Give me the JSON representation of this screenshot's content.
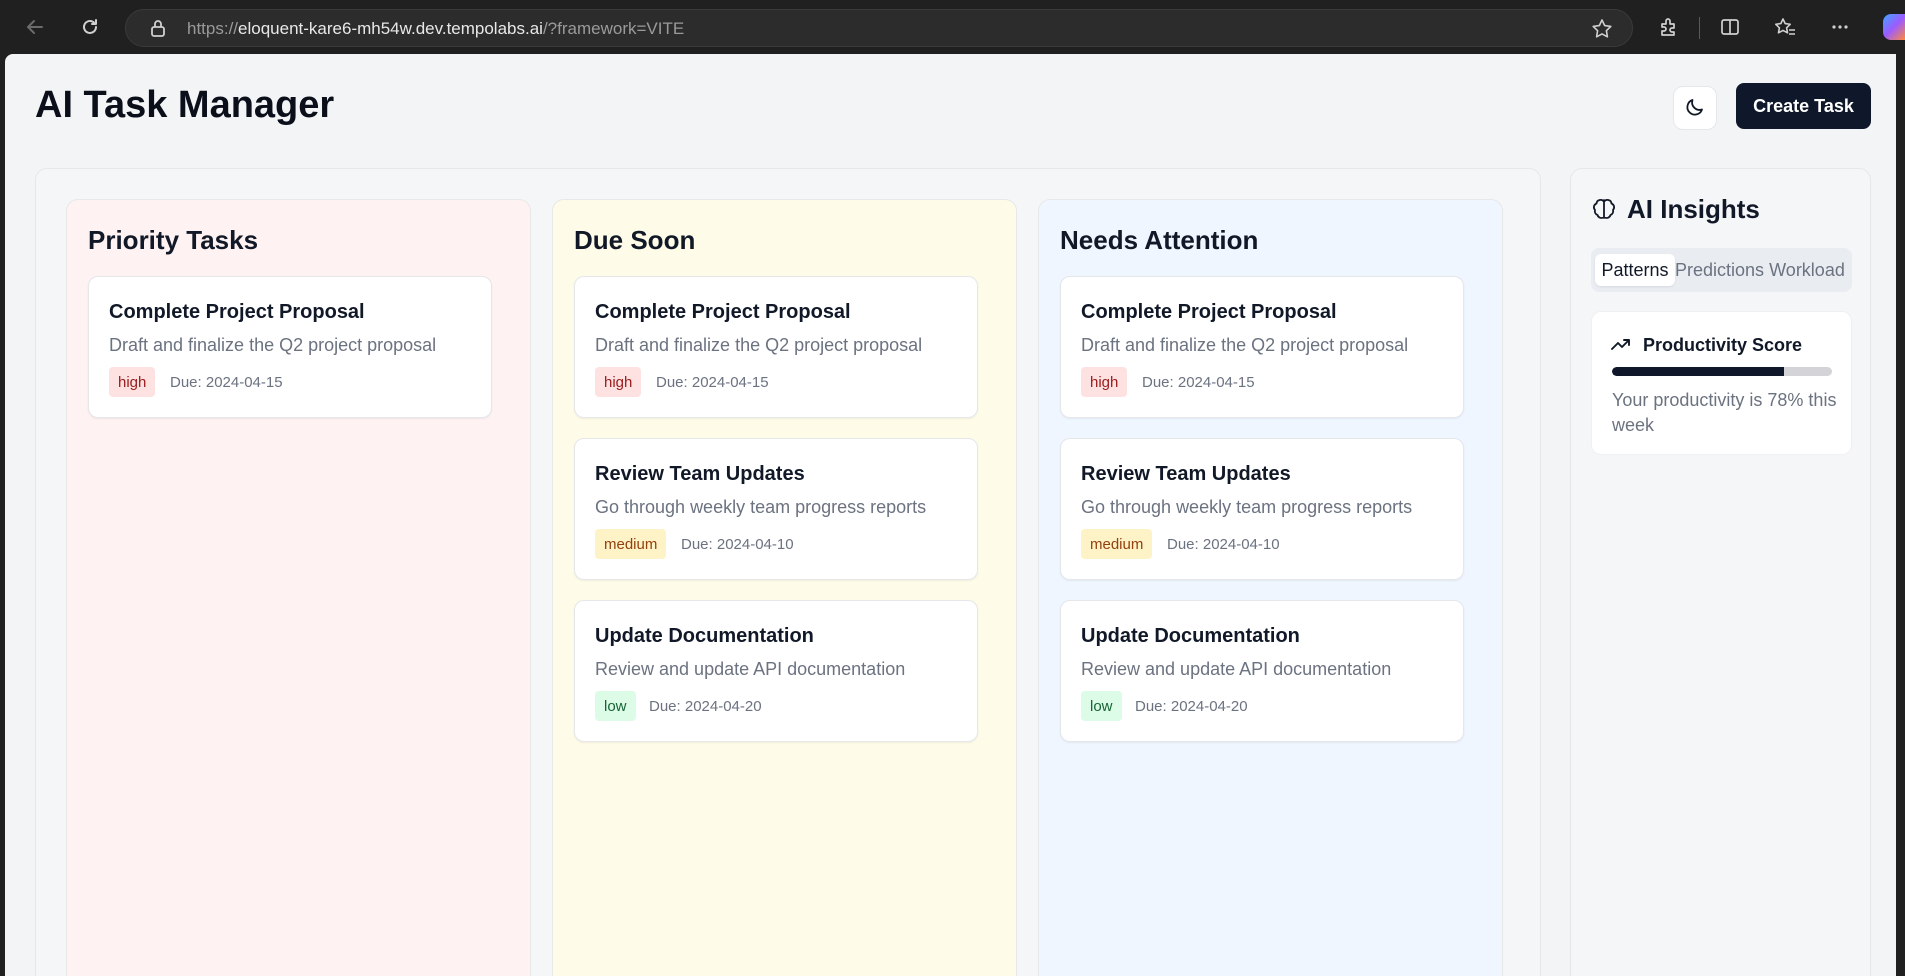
{
  "browser": {
    "url_prefix": "https://",
    "url_host": "eloquent-kare6-mh54w.dev.tempolabs.ai",
    "url_path": "/?framework=VITE"
  },
  "header": {
    "title": "AI Task Manager",
    "theme_icon": "moon-icon",
    "create_label": "Create Task"
  },
  "columns": [
    {
      "title": "Priority Tasks",
      "color": "#fef2f2",
      "tasks": [
        {
          "title": "Complete Project Proposal",
          "description": "Draft and finalize the Q2 project proposal",
          "priority": "high",
          "due": "Due: 2024-04-15"
        }
      ]
    },
    {
      "title": "Due Soon",
      "color": "#fefce8",
      "tasks": [
        {
          "title": "Complete Project Proposal",
          "description": "Draft and finalize the Q2 project proposal",
          "priority": "high",
          "due": "Due: 2024-04-15"
        },
        {
          "title": "Review Team Updates",
          "description": "Go through weekly team progress reports",
          "priority": "medium",
          "due": "Due: 2024-04-10"
        },
        {
          "title": "Update Documentation",
          "description": "Review and update API documentation",
          "priority": "low",
          "due": "Due: 2024-04-20"
        }
      ]
    },
    {
      "title": "Needs Attention",
      "color": "#eff6ff",
      "tasks": [
        {
          "title": "Complete Project Proposal",
          "description": "Draft and finalize the Q2 project proposal",
          "priority": "high",
          "due": "Due: 2024-04-15"
        },
        {
          "title": "Review Team Updates",
          "description": "Go through weekly team progress reports",
          "priority": "medium",
          "due": "Due: 2024-04-10"
        },
        {
          "title": "Update Documentation",
          "description": "Review and update API documentation",
          "priority": "low",
          "due": "Due: 2024-04-20"
        }
      ]
    }
  ],
  "insights": {
    "title": "AI Insights",
    "icon": "brain-icon",
    "tabs": [
      "Patterns",
      "Predictions",
      "Workload"
    ],
    "active_tab": "Patterns",
    "productivity": {
      "title": "Productivity Score",
      "icon": "trending-up-icon",
      "value": 0.78,
      "text": "Your productivity is 78% this week"
    }
  },
  "colors": {
    "primary": "#0f172a",
    "high": "#fee2e2",
    "medium": "#fef3c7",
    "low": "#dcfce7"
  }
}
